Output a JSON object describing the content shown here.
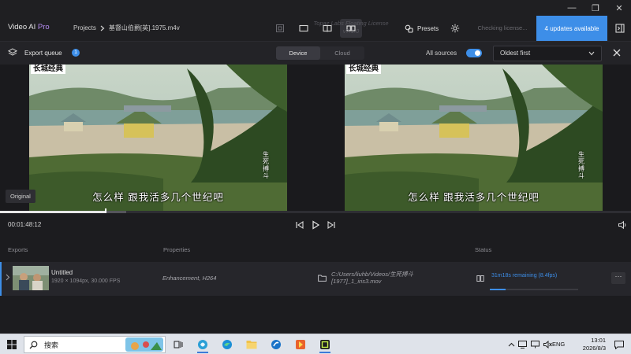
{
  "window": {
    "min_glyph": "—",
    "max_glyph": "❐",
    "close_glyph": "✕"
  },
  "header": {
    "brand": "Video AI",
    "brand_suffix": "Pro",
    "breadcrumb_root": "Projects",
    "breadcrumb_file": "基督山伯爵[英].1975.m4v",
    "trial_text": "Topaz Labs Floating License v7.1.0",
    "presets_label": "Presets",
    "license_status": "Checking license...",
    "updates_label": "4 updates available"
  },
  "queue": {
    "label": "Export queue",
    "count": "1",
    "tab_device": "Device",
    "tab_cloud": "Cloud",
    "all_sources_label": "All sources",
    "all_sources_on": true,
    "sort_value": "Oldest first"
  },
  "preview": {
    "watermark": "长城经典",
    "subtitle": "怎么样 跟我活多几个世纪吧",
    "side_text": "生死搏斗",
    "original_label": "Original",
    "timecode": "00:01:48:12",
    "playhead_fraction": 0.168,
    "buffer_fraction": 0.2
  },
  "exports": {
    "col_exports": "Exports",
    "col_properties": "Properties",
    "col_status": "Status",
    "rows": [
      {
        "name": "Untitled",
        "meta": "1920 × 1094px, 30.000 FPS",
        "properties": "Enhancement, H264",
        "path": "C:/Users/liuhb/Videos/生死搏斗[1977]_1_iris3.mov",
        "status_text": "31m18s remaining (8.4fps)",
        "progress_fraction": 0.18
      }
    ]
  },
  "taskbar": {
    "search_label": "搜索",
    "lang": "ENG",
    "time": "13:01",
    "date": "2026/8/3"
  },
  "colors": {
    "accent": "#3d8ee8",
    "brand_pro": "#b68cf2"
  }
}
